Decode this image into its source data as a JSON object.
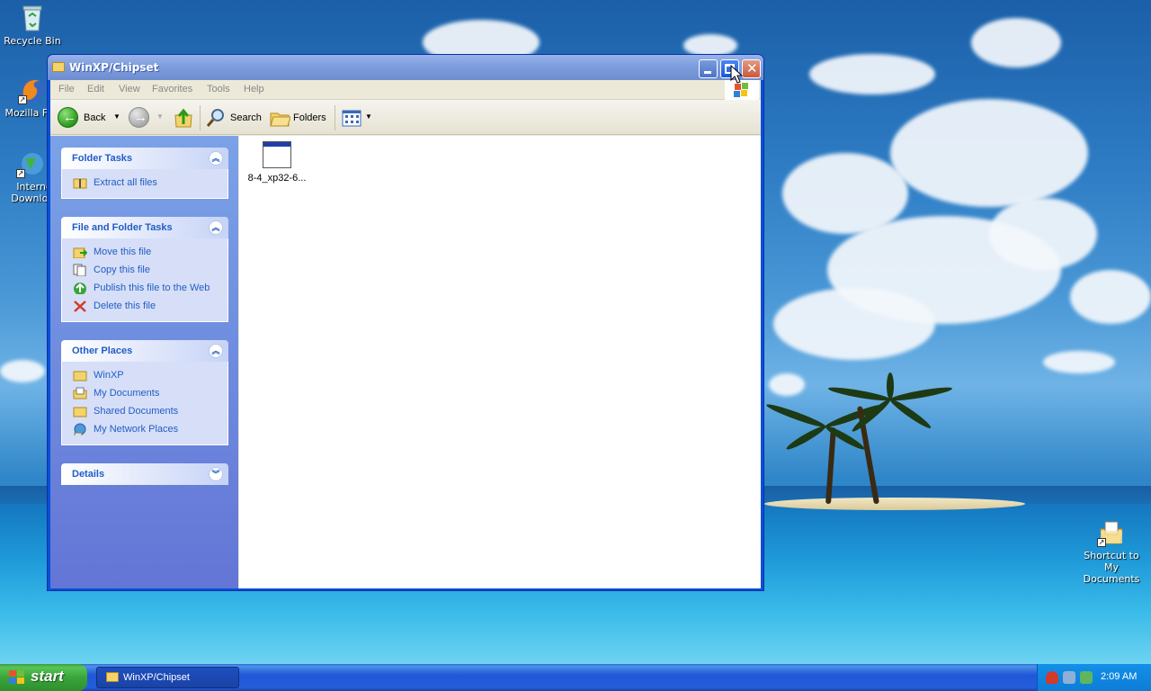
{
  "desktop": {
    "icons": [
      {
        "name": "recycle-bin",
        "label": "Recycle Bin"
      },
      {
        "name": "mozilla-firefox",
        "label": "Mozilla Fire"
      },
      {
        "name": "internet-download-manager",
        "label": "Interne Downlo..."
      },
      {
        "name": "shortcut-my-documents",
        "label": "Shortcut to My Documents"
      }
    ]
  },
  "window": {
    "title": "WinXP/Chipset",
    "menu": [
      "File",
      "Edit",
      "View",
      "Favorites",
      "Tools",
      "Help"
    ],
    "toolbar": {
      "back_label": "Back",
      "search_label": "Search",
      "folders_label": "Folders"
    },
    "panels": {
      "folder_tasks": {
        "title": "Folder Tasks",
        "items": [
          "Extract all files"
        ]
      },
      "file_folder_tasks": {
        "title": "File and Folder Tasks",
        "items": [
          "Move this file",
          "Copy this file",
          "Publish this file to the Web",
          "Delete this file"
        ]
      },
      "other_places": {
        "title": "Other Places",
        "items": [
          "WinXP",
          "My Documents",
          "Shared Documents",
          "My Network Places"
        ]
      },
      "details": {
        "title": "Details"
      }
    },
    "files": [
      {
        "name": "8-4_xp32-6..."
      }
    ]
  },
  "taskbar": {
    "start_label": "start",
    "active_task": "WinXP/Chipset",
    "clock": "2:09 AM"
  },
  "colors": {
    "taskpane_link": "#215dc6",
    "taskbar_blue": "#245edb",
    "start_green": "#3aa53a"
  }
}
